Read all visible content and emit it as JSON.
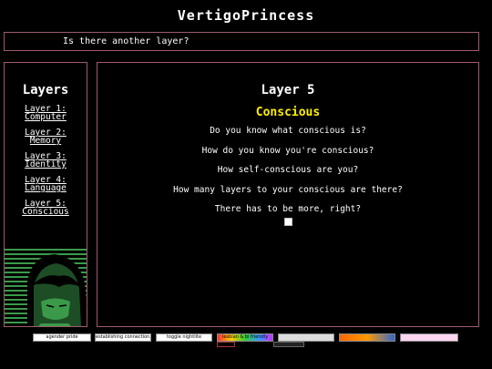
{
  "site": {
    "title": "VertigoPrincess"
  },
  "marquee": {
    "text": "Is there another layer?"
  },
  "sidebar": {
    "title": "Layers",
    "items": [
      {
        "line1": "Layer 1:",
        "line2": "Computer"
      },
      {
        "line1": "Layer 2:",
        "line2": "Memory"
      },
      {
        "line1": "Layer 3:",
        "line2": "Identity"
      },
      {
        "line1": "Layer 4:",
        "line2": "Language"
      },
      {
        "line1": "Layer 5:",
        "line2": "Conscious"
      }
    ]
  },
  "main": {
    "title": "Layer 5",
    "subtitle": "Conscious",
    "lines": [
      "Do you know what conscious is?",
      "How do you know you're conscious?",
      "How self-conscious are you?",
      "How many layers to your conscious are there?",
      "There has to be more, right?"
    ]
  },
  "footer_buttons": [
    {
      "label": "agender pride",
      "bg": "#ffffff",
      "fg": "#000000"
    },
    {
      "label": "establishing connection...",
      "bg": "#ffffff",
      "fg": "#000000"
    },
    {
      "label": "toggle nightlite",
      "bg": "#ffffff",
      "fg": "#000000"
    },
    {
      "label": "lesbian & bi friendly",
      "bg": "#ffff00",
      "fg": "#000000"
    },
    {
      "label": "",
      "bg": "#dddddd",
      "fg": "#000000"
    },
    {
      "label": "",
      "bg": "#ff9900",
      "fg": "#000000"
    },
    {
      "label": "",
      "bg": "#ffd6f0",
      "fg": "#aa3388"
    }
  ],
  "colors": {
    "accent_border": "#a05a6a",
    "subtitle": "#ffee00",
    "portrait": "#3b9a4a"
  }
}
